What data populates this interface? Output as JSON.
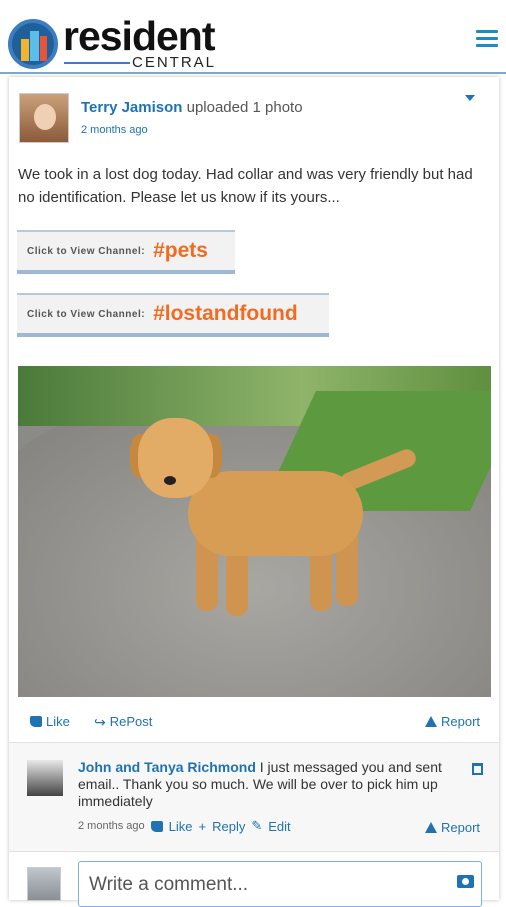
{
  "header": {
    "logo_word": "resident",
    "logo_sub": "CENTRAL",
    "menu_icon": "hamburger-icon"
  },
  "post": {
    "author": "Terry Jamison",
    "action": "uploaded 1 photo",
    "time": "2 months ago",
    "text": "We took in a lost dog today. Had collar and was very friendly but had no identification. Please let us know if its yours...",
    "channels": [
      {
        "prefix": "Click to View Channel:",
        "tag": "#pets"
      },
      {
        "prefix": "Click to View Channel:",
        "tag": "#lostandfound"
      }
    ],
    "actions": {
      "like": "Like",
      "repost": "RePost",
      "report": "Report"
    }
  },
  "comment": {
    "author": "John and Tanya Richmond",
    "text": "I just messaged you and sent email.. Thank you so much. We will be over to pick him up immediately",
    "time": "2 months ago",
    "like": "Like",
    "reply": "Reply",
    "edit": "Edit",
    "report": "Report"
  },
  "composer": {
    "placeholder": "Write a comment..."
  },
  "colors": {
    "link": "#2073b3",
    "tag": "#f26b21"
  }
}
